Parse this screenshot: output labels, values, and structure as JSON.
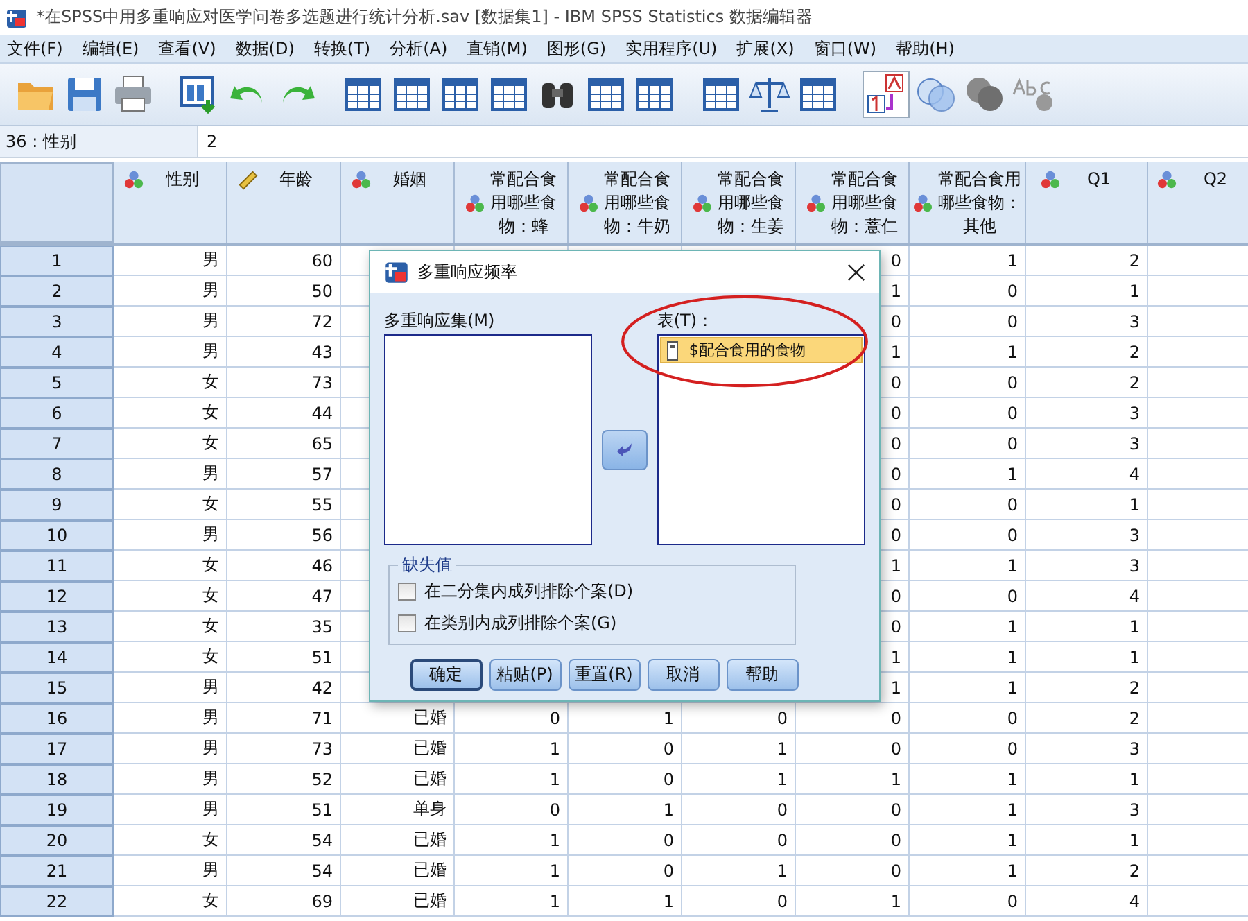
{
  "window": {
    "title": "*在SPSS中用多重响应对医学问卷多选题进行统计分析.sav [数据集1] - IBM SPSS Statistics 数据编辑器"
  },
  "menu": [
    "文件(F)",
    "编辑(E)",
    "查看(V)",
    "数据(D)",
    "转换(T)",
    "分析(A)",
    "直销(M)",
    "图形(G)",
    "实用程序(U)",
    "扩展(X)",
    "窗口(W)",
    "帮助(H)"
  ],
  "cell_ref": {
    "name": "36 : 性别",
    "value": "2"
  },
  "columns": [
    {
      "label": "性别",
      "kind": "nominal"
    },
    {
      "label": "年龄",
      "kind": "scale"
    },
    {
      "label": "婚姻",
      "kind": "nominal"
    },
    {
      "label": "常配合食用哪些食物：蜂",
      "kind": "nominal"
    },
    {
      "label": "常配合食用哪些食物：牛奶",
      "kind": "nominal"
    },
    {
      "label": "常配合食用哪些食物：生姜",
      "kind": "nominal"
    },
    {
      "label": "常配合食用哪些食物：薏仁",
      "kind": "nominal"
    },
    {
      "label": "常配合食用哪些食物：其他",
      "kind": "nominal"
    },
    {
      "label": "Q1",
      "kind": "nominal"
    },
    {
      "label": "Q2",
      "kind": "nominal"
    }
  ],
  "rows": [
    {
      "num": "1",
      "cells": [
        "男",
        "60",
        null,
        null,
        null,
        null,
        "0",
        "1",
        "2"
      ]
    },
    {
      "num": "2",
      "cells": [
        "男",
        "50",
        null,
        null,
        null,
        null,
        "1",
        "0",
        "1"
      ]
    },
    {
      "num": "3",
      "cells": [
        "男",
        "72",
        null,
        null,
        null,
        null,
        "0",
        "0",
        "3"
      ]
    },
    {
      "num": "4",
      "cells": [
        "男",
        "43",
        null,
        null,
        null,
        null,
        "1",
        "1",
        "2"
      ]
    },
    {
      "num": "5",
      "cells": [
        "女",
        "73",
        null,
        null,
        null,
        null,
        "0",
        "0",
        "2"
      ]
    },
    {
      "num": "6",
      "cells": [
        "女",
        "44",
        null,
        null,
        null,
        null,
        "0",
        "0",
        "3"
      ]
    },
    {
      "num": "7",
      "cells": [
        "女",
        "65",
        null,
        null,
        null,
        null,
        "0",
        "0",
        "3"
      ]
    },
    {
      "num": "8",
      "cells": [
        "男",
        "57",
        null,
        null,
        null,
        null,
        "0",
        "1",
        "4"
      ]
    },
    {
      "num": "9",
      "cells": [
        "女",
        "55",
        null,
        null,
        null,
        null,
        "0",
        "0",
        "1"
      ]
    },
    {
      "num": "10",
      "cells": [
        "男",
        "56",
        null,
        null,
        null,
        null,
        "0",
        "0",
        "3"
      ]
    },
    {
      "num": "11",
      "cells": [
        "女",
        "46",
        null,
        null,
        null,
        null,
        "1",
        "1",
        "3"
      ]
    },
    {
      "num": "12",
      "cells": [
        "女",
        "47",
        null,
        null,
        null,
        null,
        "0",
        "0",
        "4"
      ]
    },
    {
      "num": "13",
      "cells": [
        "女",
        "35",
        null,
        null,
        null,
        null,
        "0",
        "1",
        "1"
      ]
    },
    {
      "num": "14",
      "cells": [
        "女",
        "51",
        null,
        null,
        null,
        null,
        "1",
        "1",
        "1"
      ]
    },
    {
      "num": "15",
      "cells": [
        "男",
        "42",
        null,
        null,
        null,
        null,
        "1",
        "1",
        "2"
      ]
    },
    {
      "num": "16",
      "cells": [
        "男",
        "71",
        "已婚",
        "0",
        "1",
        "0",
        "0",
        "0",
        "2"
      ]
    },
    {
      "num": "17",
      "cells": [
        "男",
        "73",
        "已婚",
        "1",
        "0",
        "1",
        "0",
        "0",
        "3"
      ]
    },
    {
      "num": "18",
      "cells": [
        "男",
        "52",
        "已婚",
        "1",
        "0",
        "1",
        "1",
        "1",
        "1"
      ]
    },
    {
      "num": "19",
      "cells": [
        "男",
        "51",
        "单身",
        "0",
        "1",
        "0",
        "0",
        "1",
        "3"
      ]
    },
    {
      "num": "20",
      "cells": [
        "女",
        "54",
        "已婚",
        "1",
        "0",
        "0",
        "0",
        "1",
        "1"
      ]
    },
    {
      "num": "21",
      "cells": [
        "男",
        "54",
        "已婚",
        "1",
        "0",
        "1",
        "0",
        "1",
        "2"
      ]
    },
    {
      "num": "22",
      "cells": [
        "女",
        "69",
        "已婚",
        "1",
        "1",
        "0",
        "1",
        "0",
        "4"
      ]
    }
  ],
  "dialog": {
    "title": "多重响应频率",
    "sets_label": "多重响应集(M)",
    "table_label": "表(T)：",
    "table_items": [
      {
        "label": "$配合食用的食物",
        "selected": true
      }
    ],
    "annotation": {
      "kind": "ellipse"
    },
    "missing": {
      "title": "缺失值",
      "options": [
        {
          "label": "在二分集内成列排除个案(D)",
          "checked": false
        },
        {
          "label": "在类别内成列排除个案(G)",
          "checked": false
        }
      ]
    },
    "buttons": [
      {
        "label": "确定",
        "default": true
      },
      {
        "label": "粘贴(P)",
        "default": false
      },
      {
        "label": "重置(R)",
        "default": false
      },
      {
        "label": "取消",
        "default": false
      },
      {
        "label": "帮助",
        "default": false
      }
    ]
  }
}
